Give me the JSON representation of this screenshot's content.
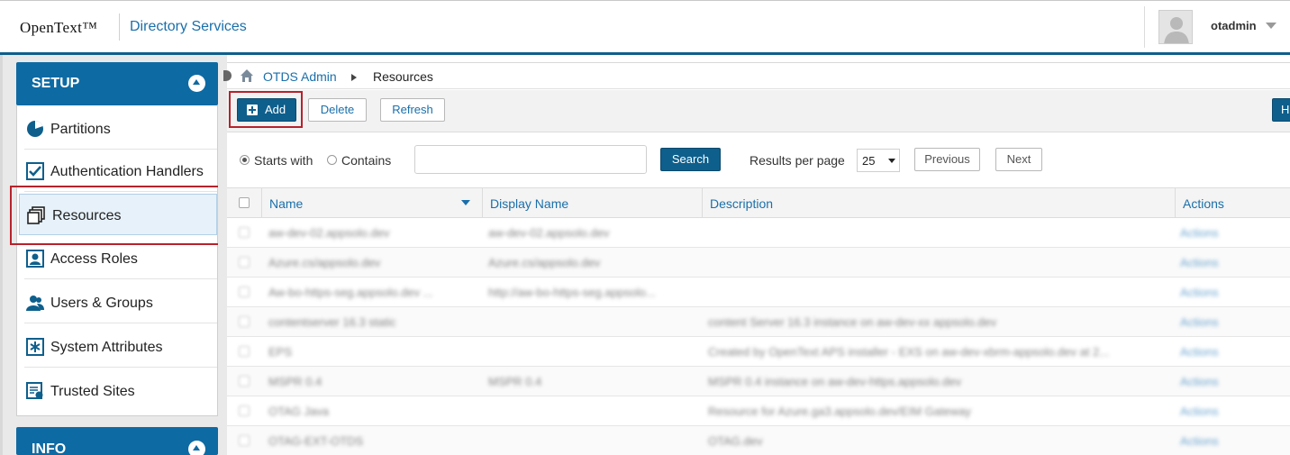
{
  "header": {
    "brand": "OpenText™",
    "product": "Directory Services",
    "user_name": "otadmin"
  },
  "sidebar": {
    "setup_title": "SETUP",
    "info_title": "INFO",
    "items": [
      {
        "label": "Partitions",
        "icon": "partitions-icon"
      },
      {
        "label": "Authentication Handlers",
        "icon": "checkbox-icon"
      },
      {
        "label": "Resources",
        "icon": "resources-icon",
        "active": true
      },
      {
        "label": "Access Roles",
        "icon": "access-roles-icon"
      },
      {
        "label": "Users & Groups",
        "icon": "users-icon"
      },
      {
        "label": "System Attributes",
        "icon": "asterisk-icon"
      },
      {
        "label": "Trusted Sites",
        "icon": "trusted-sites-icon"
      }
    ]
  },
  "breadcrumb": {
    "root": "OTDS Admin",
    "current": "Resources"
  },
  "toolbar": {
    "add_label": "Add",
    "delete_label": "Delete",
    "refresh_label": "Refresh",
    "help_label": "H"
  },
  "search": {
    "mode_starts": "Starts with",
    "mode_contains": "Contains",
    "selected_mode": "Starts with",
    "query": "",
    "button": "Search",
    "rpp_label": "Results per page",
    "rpp_value": "25",
    "previous": "Previous",
    "next": "Next"
  },
  "table": {
    "columns": [
      "Name",
      "Display Name",
      "Description",
      "Actions"
    ],
    "rows": [
      {
        "name": "aw-dev-02.appsolo.dev",
        "display": "aw-dev-02.appsolo.dev",
        "description": "",
        "actions": "Actions"
      },
      {
        "name": "Azure.cs/appsolo.dev",
        "display": "Azure.cs/appsolo.dev",
        "description": "",
        "actions": "Actions"
      },
      {
        "name": "Aw-bo-https-seg.appsolo.dev ...",
        "display": "http://aw-bo-https-seg.appsolo...",
        "description": "",
        "actions": "Actions"
      },
      {
        "name": "contentserver 16.3 static",
        "display": "",
        "description": "content Server 16.3 instance on aw-dev-xx appsolo.dev",
        "actions": "Actions"
      },
      {
        "name": "EPS",
        "display": "",
        "description": "Created by OpenText APS installer - EXS on aw-dev-xbrm-appsolo.dev at 2...",
        "actions": "Actions"
      },
      {
        "name": "MSPR 0.4",
        "display": "MSPR 0.4",
        "description": "MSPR 0.4 instance on aw-dev-https.appsolo.dev",
        "actions": "Actions"
      },
      {
        "name": "OTAG Java",
        "display": "",
        "description": "Resource for Azure.ga3.appsolo.dev/EIM Gateway",
        "actions": "Actions"
      },
      {
        "name": "OTAG-EXT-OTDS",
        "display": "",
        "description": "OTAG.dev",
        "actions": "Actions"
      }
    ]
  }
}
